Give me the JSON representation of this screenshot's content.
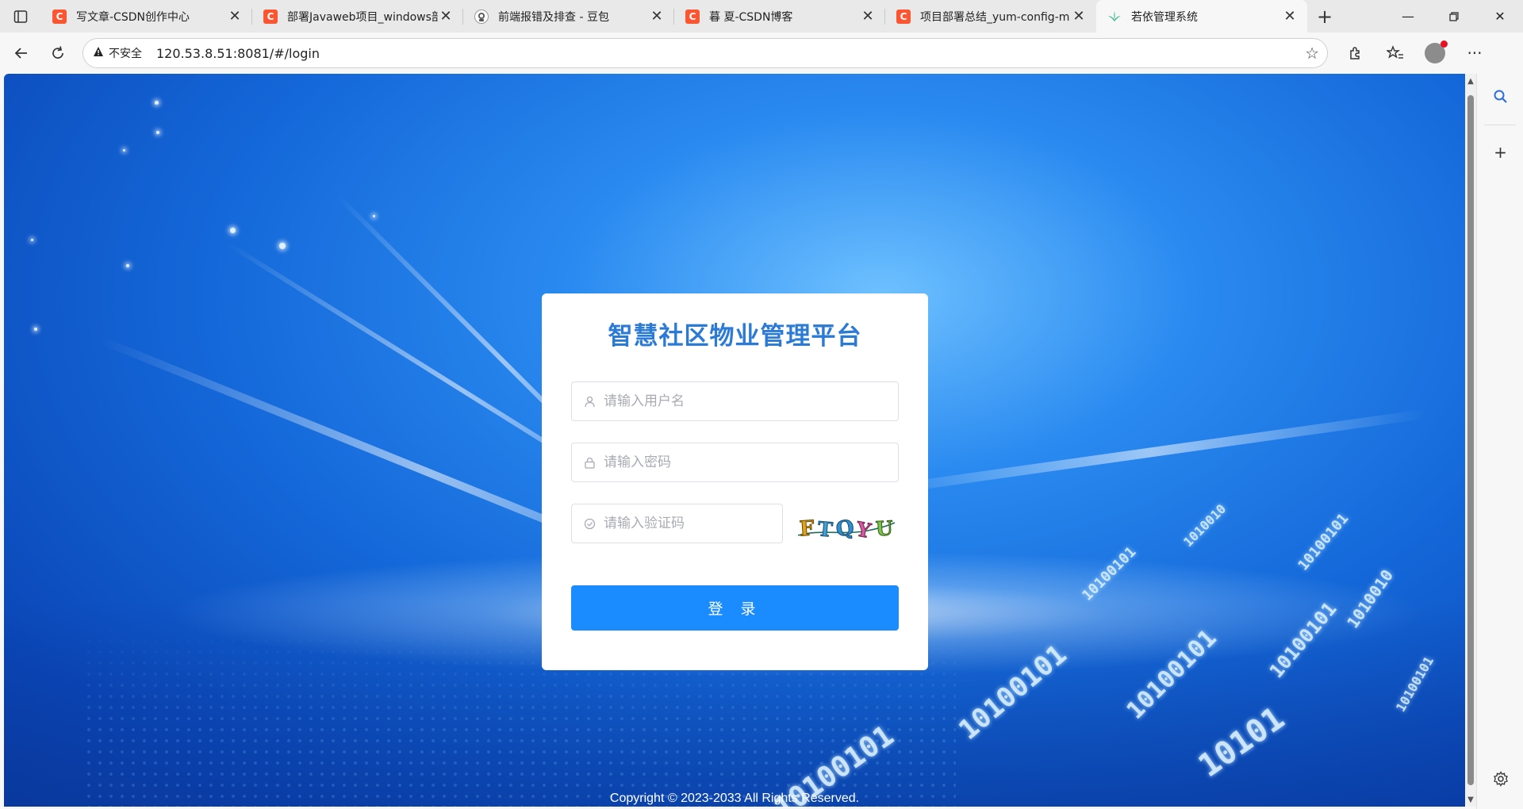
{
  "tabs": [
    {
      "title": "写文章-CSDN创作中心",
      "favicon": "csdn-icon",
      "active": false
    },
    {
      "title": "部署Javaweb项目_windows部",
      "favicon": "csdn-icon",
      "active": false
    },
    {
      "title": "前端报错及排查 - 豆包",
      "favicon": "doubao-icon",
      "active": false
    },
    {
      "title": "暮 夏-CSDN博客",
      "favicon": "csdn-icon",
      "active": false
    },
    {
      "title": "项目部署总结_yum-config-m",
      "favicon": "csdn-icon",
      "active": false
    },
    {
      "title": "若依管理系统",
      "favicon": "ruoyi-icon",
      "active": true
    }
  ],
  "address_bar": {
    "security_label": "不安全",
    "url": "120.53.8.51:8081/#/login"
  },
  "login": {
    "title": "智慧社区物业管理平台",
    "username_placeholder": "请输入用户名",
    "password_placeholder": "请输入密码",
    "captcha_placeholder": "请输入验证码",
    "captcha_text": "FTQYU",
    "submit_label": "登 录"
  },
  "footer": {
    "copyright": "Copyright © 2023-2033 All Rights Reserved."
  },
  "colors": {
    "title": "#2b7bd6",
    "button": "#1a8cff",
    "csdn_brand": "#fc5531"
  }
}
